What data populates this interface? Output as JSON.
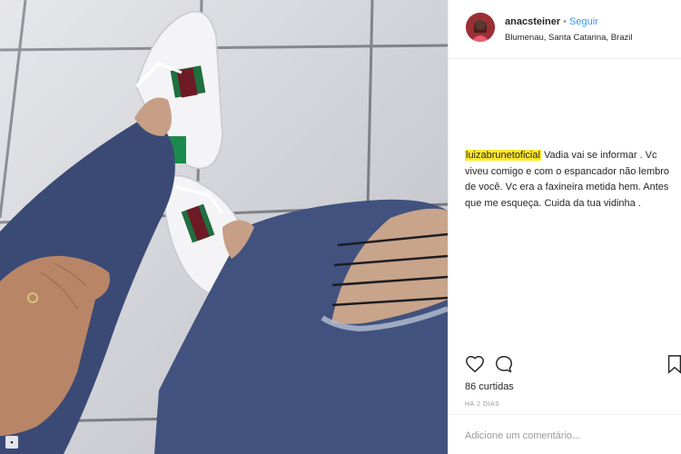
{
  "post": {
    "username": "anacsteiner",
    "separator": "•",
    "follow_label": "Seguir",
    "location": "Blumenau, Santa Catarina, Brazil"
  },
  "comment": {
    "author": "luizabrunetoficial",
    "text": "Vadia vai se informar . Vc viveu comigo e com o espancador não lembro de você. Vc era a faxineira metida hem. Antes que me esqueça. Cuida da tua vidinha ."
  },
  "stats": {
    "likes": "86 curtidas",
    "time": "HÁ 2 DIAS"
  },
  "input": {
    "placeholder": "Adicione um comentário..."
  },
  "icons": {
    "like": "heart-icon",
    "comment": "comment-icon",
    "save": "bookmark-icon",
    "post_type": "post-type-icon"
  },
  "colors": {
    "highlight": "#ffe82a",
    "follow": "#3897f0"
  }
}
